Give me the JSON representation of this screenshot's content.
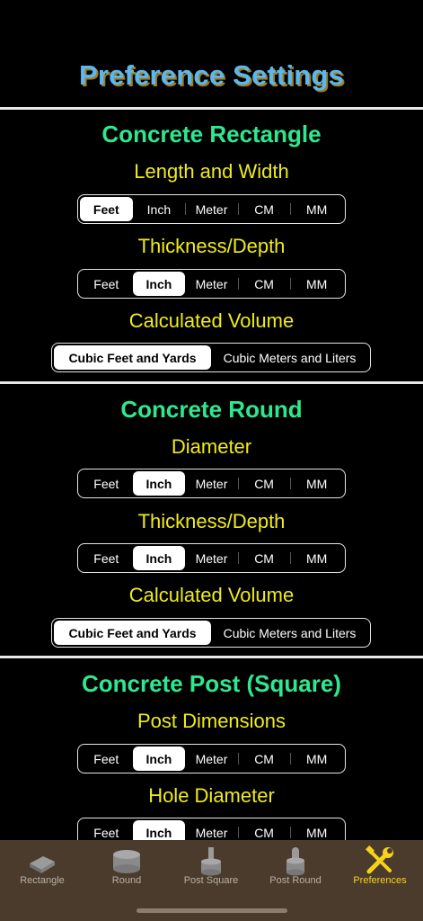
{
  "page_title": "Preference Settings",
  "sections": [
    {
      "title": "Concrete Rectangle",
      "groups": [
        {
          "label": "Length and Width",
          "options": [
            "Feet",
            "Inch",
            "Meter",
            "CM",
            "MM"
          ],
          "selected": "Feet"
        },
        {
          "label": "Thickness/Depth",
          "options": [
            "Feet",
            "Inch",
            "Meter",
            "CM",
            "MM"
          ],
          "selected": "Inch"
        },
        {
          "label": "Calculated Volume",
          "options": [
            "Cubic Feet and Yards",
            "Cubic Meters and Liters"
          ],
          "selected": "Cubic Feet and Yards"
        }
      ]
    },
    {
      "title": "Concrete Round",
      "groups": [
        {
          "label": "Diameter",
          "options": [
            "Feet",
            "Inch",
            "Meter",
            "CM",
            "MM"
          ],
          "selected": "Inch"
        },
        {
          "label": "Thickness/Depth",
          "options": [
            "Feet",
            "Inch",
            "Meter",
            "CM",
            "MM"
          ],
          "selected": "Inch"
        },
        {
          "label": "Calculated Volume",
          "options": [
            "Cubic Feet and Yards",
            "Cubic Meters and Liters"
          ],
          "selected": "Cubic Feet and Yards"
        }
      ]
    },
    {
      "title": "Concrete Post (Square)",
      "groups": [
        {
          "label": "Post Dimensions",
          "options": [
            "Feet",
            "Inch",
            "Meter",
            "CM",
            "MM"
          ],
          "selected": "Inch"
        },
        {
          "label": "Hole Diameter",
          "options": [
            "Feet",
            "Inch",
            "Meter",
            "CM",
            "MM"
          ],
          "selected": "Inch"
        }
      ]
    }
  ],
  "tabs": [
    {
      "label": "Rectangle",
      "icon": "rectangle-slab-icon",
      "active": false
    },
    {
      "label": "Round",
      "icon": "round-slab-icon",
      "active": false
    },
    {
      "label": "Post Square",
      "icon": "post-square-icon",
      "active": false
    },
    {
      "label": "Post Round",
      "icon": "post-round-icon",
      "active": false
    },
    {
      "label": "Preferences",
      "icon": "tools-icon",
      "active": true
    }
  ],
  "colors": {
    "title": "#5ab8f0",
    "section": "#2ee88f",
    "label": "#f0ec1a",
    "tabbar": "#4a3b2c",
    "tab_active": "#f7d21a"
  }
}
